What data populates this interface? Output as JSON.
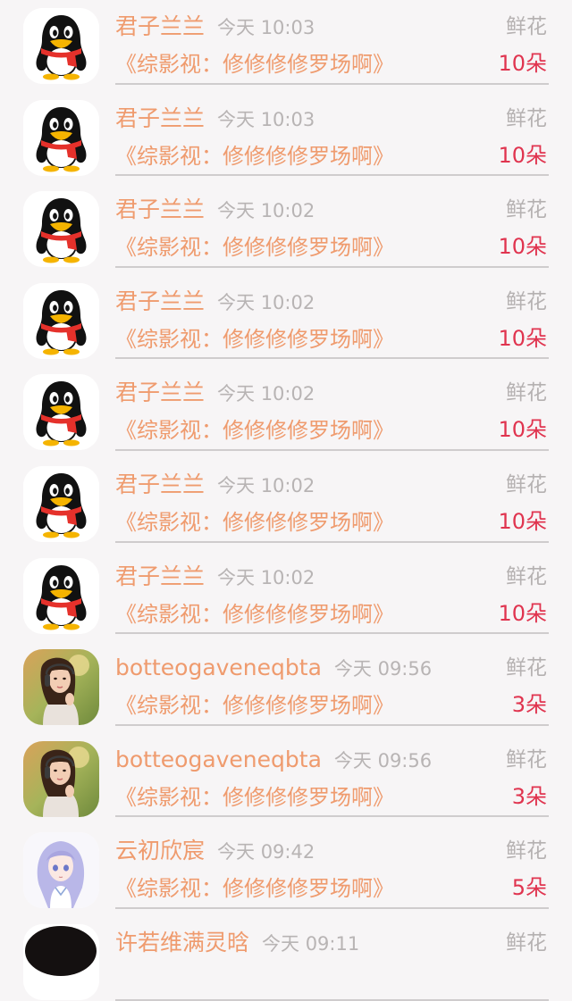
{
  "records": [
    {
      "avatar": "qq-penguin",
      "name": "君子兰兰",
      "time": "今天 10:03",
      "gift": "鲜花",
      "program": "《综影视：修修修修罗场啊》",
      "count": "10朵"
    },
    {
      "avatar": "qq-penguin",
      "name": "君子兰兰",
      "time": "今天 10:03",
      "gift": "鲜花",
      "program": "《综影视：修修修修罗场啊》",
      "count": "10朵"
    },
    {
      "avatar": "qq-penguin",
      "name": "君子兰兰",
      "time": "今天 10:02",
      "gift": "鲜花",
      "program": "《综影视：修修修修罗场啊》",
      "count": "10朵"
    },
    {
      "avatar": "qq-penguin",
      "name": "君子兰兰",
      "time": "今天 10:02",
      "gift": "鲜花",
      "program": "《综影视：修修修修罗场啊》",
      "count": "10朵"
    },
    {
      "avatar": "qq-penguin",
      "name": "君子兰兰",
      "time": "今天 10:02",
      "gift": "鲜花",
      "program": "《综影视：修修修修罗场啊》",
      "count": "10朵"
    },
    {
      "avatar": "qq-penguin",
      "name": "君子兰兰",
      "time": "今天 10:02",
      "gift": "鲜花",
      "program": "《综影视：修修修修罗场啊》",
      "count": "10朵"
    },
    {
      "avatar": "qq-penguin",
      "name": "君子兰兰",
      "time": "今天 10:02",
      "gift": "鲜花",
      "program": "《综影视：修修修修罗场啊》",
      "count": "10朵"
    },
    {
      "avatar": "girl-headphones-photo",
      "name": "botteogaveneqbta",
      "time": "今天 09:56",
      "gift": "鲜花",
      "program": "《综影视：修修修修罗场啊》",
      "count": "3朵"
    },
    {
      "avatar": "girl-headphones-photo",
      "name": "botteogaveneqbta",
      "time": "今天 09:56",
      "gift": "鲜花",
      "program": "《综影视：修修修修罗场啊》",
      "count": "3朵"
    },
    {
      "avatar": "anime-girl-illustration",
      "name": "云初欣宸",
      "time": "今天 09:42",
      "gift": "鲜花",
      "program": "《综影视：修修修修罗场啊》",
      "count": "5朵"
    },
    {
      "avatar": "dark-photo",
      "name": "许若维满灵晗",
      "time": "今天 09:11",
      "gift": "鲜花",
      "program": "",
      "count": ""
    }
  ],
  "colors": {
    "background": "#f7f5f6",
    "name": "#ef9b6e",
    "time": "#b8b4b4",
    "gift": "#b5b1b1",
    "count": "#e0344f",
    "divider": "#cfcccd"
  }
}
